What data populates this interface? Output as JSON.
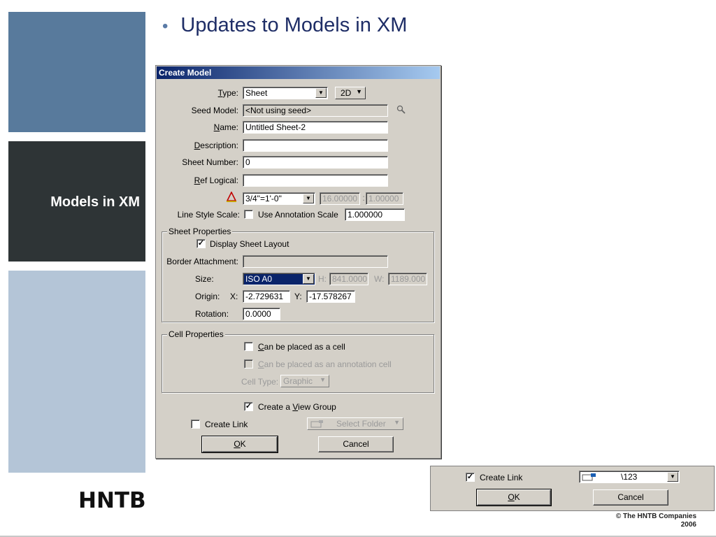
{
  "slide": {
    "title": "Updates to Models in XM",
    "bullet": "•",
    "side_title": "Models in XM",
    "logo": "HNTB",
    "copyright_line1": "© The HNTB Companies",
    "copyright_line2": "2006"
  },
  "dialog": {
    "title": "Create Model",
    "type_label_prefix": "T",
    "type_label_rest": "ype:",
    "type_value": "Sheet",
    "dim_value": "2D",
    "seed_label": "Seed Model:",
    "seed_value": "<Not using seed>",
    "name_label_prefix": "N",
    "name_label_rest": "ame:",
    "name_value": "Untitled Sheet-2",
    "description_label_prefix": "D",
    "description_label_rest": "escription:",
    "description_value": "",
    "sheet_number_label": "Sheet Number:",
    "sheet_number_value": "0",
    "ref_logical_label_prefix": "R",
    "ref_logical_label_rest": "ef Logical:",
    "ref_logical_value": "",
    "scale_value": "3/4\"=1'-0\"",
    "scale_num1": "16.00000",
    "scale_sep": ":",
    "scale_num2": "1.00000",
    "line_style_label": "Line Style Scale:",
    "use_annotation_label": "Use Annotation Scale",
    "use_annotation_checked": false,
    "line_style_value": "1.000000",
    "sheet_props": {
      "title": "Sheet Properties",
      "display_layout_label": "Display Sheet Layout",
      "display_layout_checked": true,
      "border_label": "Border Attachment:",
      "border_value": "",
      "size_label": "Size:",
      "size_value": "ISO A0",
      "h_label": "H:",
      "h_value": "841.0000",
      "w_label": "W:",
      "w_value": "1189.000",
      "origin_label": "Origin:",
      "x_label": "X:",
      "x_value": "-2.729631",
      "y_label": "Y:",
      "y_value": "-17.578267",
      "rotation_label": "Rotation:",
      "rotation_value": "0.0000"
    },
    "cell_props": {
      "title": "Cell Properties",
      "placed_cell_label_prefix": "C",
      "placed_cell_label_rest": "an be placed as a cell",
      "placed_cell_checked": false,
      "annotation_cell_label_prefix": "C",
      "annotation_cell_label_rest": "an be placed as an annotation cell",
      "annotation_cell_checked": false,
      "cell_type_label": "Cell Type:",
      "cell_type_value": "Graphic"
    },
    "view_group_label_pre": "Create a ",
    "view_group_label_u": "V",
    "view_group_label_post": "iew Group",
    "view_group_checked": true,
    "create_link_label": "Create Link",
    "create_link_checked": false,
    "select_folder_value": "Select Folder",
    "ok_label_u": "O",
    "ok_label_rest": "K",
    "cancel_label": "Cancel"
  },
  "strip": {
    "create_link_label": "Create Link",
    "create_link_checked": true,
    "folder_value": "\\123",
    "ok_label_u": "O",
    "ok_label_rest": "K",
    "cancel_label": "Cancel"
  },
  "colors": {
    "block_top": "#587a9c",
    "block_mid": "#2e3436",
    "block_bottom": "#b4c5d7",
    "title_color": "#1e2d66",
    "dialog_bg": "#d4d0c8",
    "titlebar": "#0a246a"
  }
}
